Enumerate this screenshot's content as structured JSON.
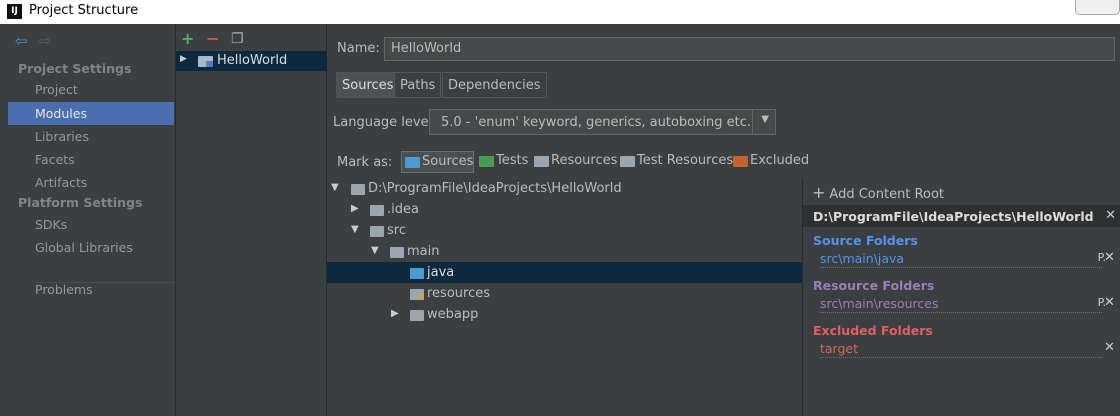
{
  "window": {
    "title": "Project Structure",
    "app_icon": "IJ"
  },
  "nav": {
    "back_icon": "back-arrow-icon",
    "forward_icon": "forward-arrow-icon",
    "project_settings_title": "Project Settings",
    "project_items": [
      "Project",
      "Modules",
      "Libraries",
      "Facets",
      "Artifacts"
    ],
    "platform_settings_title": "Platform Settings",
    "platform_items": [
      "SDKs",
      "Global Libraries"
    ],
    "problems": "Problems",
    "selected": "Modules"
  },
  "modules": {
    "toolbar": [
      "add-icon",
      "remove-icon",
      "copy-icon"
    ],
    "items": [
      "HelloWorld"
    ]
  },
  "main": {
    "name_label": "Name:",
    "name_value": "HelloWorld",
    "tabs": [
      "Sources",
      "Paths",
      "Dependencies"
    ],
    "active_tab": "Sources",
    "language_level_label": "Language level:",
    "language_level_value": "5.0 - 'enum' keyword, generics, autoboxing etc.",
    "mark_as_label": "Mark as:",
    "mark_options": [
      {
        "label": "Sources",
        "color": "#4c9ad0"
      },
      {
        "label": "Tests",
        "color": "#499c54"
      },
      {
        "label": "Resources",
        "color": "#9aa7b0"
      },
      {
        "label": "Test Resources",
        "color": "#9aa7b0"
      },
      {
        "label": "Excluded",
        "color": "#c5642f"
      }
    ]
  },
  "tree": [
    {
      "label": "D:\\ProgramFile\\IdeaProjects\\HelloWorld",
      "depth": 0,
      "expanded": true
    },
    {
      "label": ".idea",
      "depth": 1,
      "expanded": false
    },
    {
      "label": "src",
      "depth": 1,
      "expanded": true
    },
    {
      "label": "main",
      "depth": 2,
      "expanded": true
    },
    {
      "label": "java",
      "depth": 3,
      "selected": true,
      "kind": "source"
    },
    {
      "label": "resources",
      "depth": 3,
      "kind": "resource"
    },
    {
      "label": "webapp",
      "depth": 3,
      "expanded": false
    }
  ],
  "content_root": {
    "add_label": "Add Content Root",
    "root_path": "D:\\ProgramFile\\IdeaProjects\\HelloWorld",
    "source_title": "Source Folders",
    "source_path": "src\\main\\java",
    "resource_title": "Resource Folders",
    "resource_path": "src\\main\\resources",
    "excluded_title": "Excluded Folders",
    "excluded_path": "target",
    "colors": {
      "source": "#5394ec",
      "resource": "#9a7fb4",
      "excluded": "#e05f5f"
    }
  }
}
